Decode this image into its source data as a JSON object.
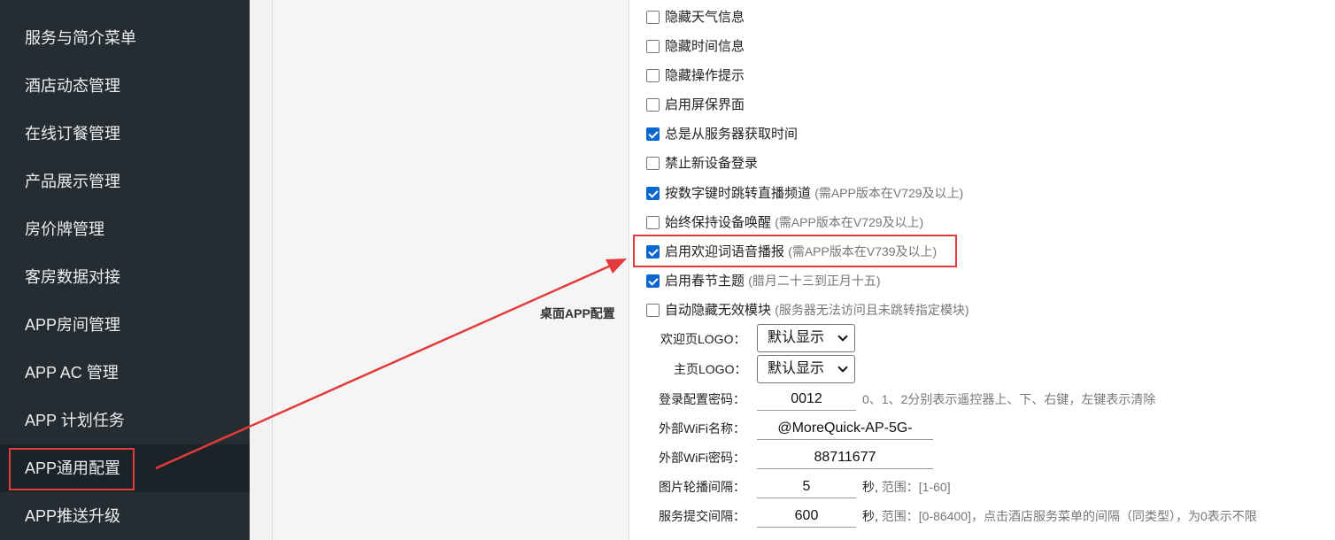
{
  "sidebar": {
    "items": [
      {
        "label": "服务与简介菜单"
      },
      {
        "label": "酒店动态管理"
      },
      {
        "label": "在线订餐管理"
      },
      {
        "label": "产品展示管理"
      },
      {
        "label": "房价牌管理"
      },
      {
        "label": "客房数据对接"
      },
      {
        "label": "APP房间管理"
      },
      {
        "label": "APP AC 管理"
      },
      {
        "label": "APP 计划任务"
      },
      {
        "label": "APP通用配置"
      },
      {
        "label": "APP推送升级"
      }
    ],
    "active_index": 9
  },
  "section": {
    "label": "桌面APP配置"
  },
  "options": [
    {
      "label": "隐藏天气信息",
      "note": "",
      "checked": false
    },
    {
      "label": "隐藏时间信息",
      "note": "",
      "checked": false
    },
    {
      "label": "隐藏操作提示",
      "note": "",
      "checked": false
    },
    {
      "label": "启用屏保界面",
      "note": "",
      "checked": false
    },
    {
      "label": "总是从服务器获取时间",
      "note": "",
      "checked": true
    },
    {
      "label": "禁止新设备登录",
      "note": "",
      "checked": false
    },
    {
      "label": "按数字键时跳转直播频道",
      "note": "(需APP版本在V729及以上)",
      "checked": true
    },
    {
      "label": "始终保持设备唤醒",
      "note": "(需APP版本在V729及以上)",
      "checked": false
    },
    {
      "label": "启用欢迎词语音播报",
      "note": "(需APP版本在V739及以上)",
      "checked": true
    },
    {
      "label": "启用春节主题",
      "note": "(腊月二十三到正月十五)",
      "checked": true
    },
    {
      "label": "自动隐藏无效模块",
      "note": "(服务器无法访问且未跳转指定模块)",
      "checked": false
    }
  ],
  "form": {
    "welcome_logo": {
      "label": "欢迎页LOGO：",
      "value": "默认显示"
    },
    "home_logo": {
      "label": "主页LOGO：",
      "value": "默认显示"
    },
    "login_password": {
      "label": "登录配置密码：",
      "value": "0012",
      "hint": "0、1、2分别表示遥控器上、下、右键，左键表示清除"
    },
    "wifi_name": {
      "label": "外部WiFi名称：",
      "value": "@MoreQuick-AP-5G-"
    },
    "wifi_password": {
      "label": "外部WiFi密码：",
      "value": "88711677"
    },
    "carousel_interval": {
      "label": "图片轮播间隔：",
      "value": "5",
      "unit": "秒,",
      "hint": "范围：[1-60]"
    },
    "submit_interval": {
      "label": "服务提交间隔：",
      "value": "600",
      "unit": "秒,",
      "hint": "范围：[0-86400]，点击酒店服务菜单的间隔（同类型），为0表示不限"
    }
  },
  "colors": {
    "sidebar_bg": "#252d33",
    "annotation_red": "#e23b3b",
    "checkbox_blue": "#0b67d0"
  }
}
